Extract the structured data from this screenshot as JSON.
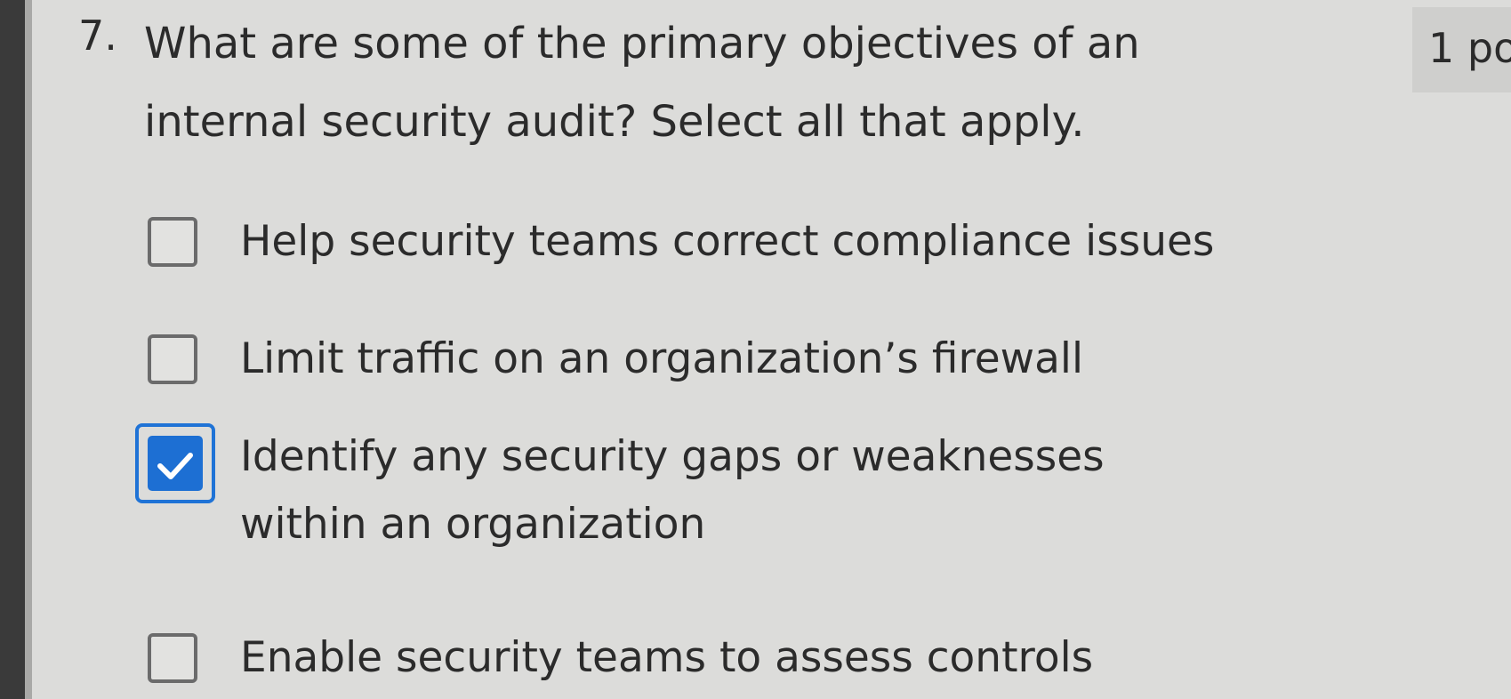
{
  "question": {
    "number": "7.",
    "text": "What are some of the primary objectives of an internal security audit? Select all that apply.",
    "points": "1 po"
  },
  "options": [
    {
      "label": "Help security teams correct compliance issues",
      "checked": false
    },
    {
      "label": "Limit traffic on an organization’s firewall",
      "checked": false
    },
    {
      "label": "Identify any security gaps or weaknesses within an organization",
      "checked": true
    },
    {
      "label": "Enable security teams to assess controls",
      "checked": false
    }
  ],
  "colors": {
    "accent": "#1d6fd3",
    "background": "#dcdcda",
    "text": "#2b2b2b"
  },
  "icons": {
    "checkbox": "checkbox-icon",
    "checkmark": "checkmark-icon"
  }
}
